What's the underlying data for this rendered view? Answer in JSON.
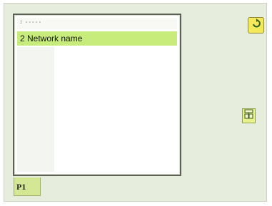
{
  "list": {
    "header": "2 ∘∘∘∘∘",
    "items": [
      {
        "label": "2 Network name",
        "selected": true
      }
    ]
  },
  "page_tab": {
    "label": "P1"
  },
  "icons": {
    "refresh": "refresh-icon",
    "network": "network-icon"
  },
  "colors": {
    "background": "#e6eddd",
    "selection": "#c7ec7b",
    "button_yellow": "#f4e95a",
    "tab_green": "#d3e795"
  }
}
